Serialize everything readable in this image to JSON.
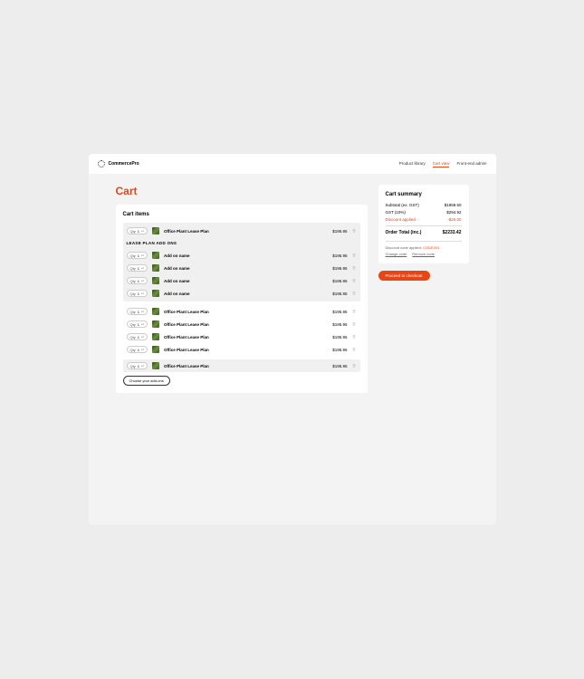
{
  "header": {
    "brand": "CommercePro",
    "nav": [
      "Product library",
      "Cart view",
      "Front-end admin"
    ],
    "nav_active": 1
  },
  "page_title": "Cart",
  "items_card": {
    "title": "Cart items",
    "qty_label": "Qty",
    "addons_heading": "LEASE PLAN ADD ONS",
    "choose_label": "Choose your add-ons"
  },
  "cart": {
    "main_item": {
      "qty": "1",
      "name": "Office Plant Lease Plan",
      "price": "$195.95"
    },
    "addons": [
      {
        "qty": "1",
        "name": "Add on name",
        "price": "$195.95"
      },
      {
        "qty": "1",
        "name": "Add on name",
        "price": "$195.95"
      },
      {
        "qty": "1",
        "name": "Add on name",
        "price": "$195.95"
      },
      {
        "qty": "1",
        "name": "Add on name",
        "price": "$195.95"
      }
    ],
    "other_items": [
      {
        "qty": "1",
        "name": "Office Plant Lease Plan",
        "price": "$195.95"
      },
      {
        "qty": "1",
        "name": "Office Plant Lease Plan",
        "price": "$195.95"
      },
      {
        "qty": "1",
        "name": "Office Plant Lease Plan",
        "price": "$195.95"
      },
      {
        "qty": "1",
        "name": "Office Plant Lease Plan",
        "price": "$195.95"
      }
    ],
    "last_item": {
      "qty": "1",
      "name": "Office Plant Lease Plan",
      "price": "$195.95"
    }
  },
  "summary": {
    "title": "Cart summary",
    "rows": [
      {
        "label": "Subtotal (ex. GST)",
        "value": "$1959.50"
      },
      {
        "label": "GST (10%)",
        "value": "$294.92"
      }
    ],
    "discount": {
      "label": "Discount applied",
      "value": "-$20.00"
    },
    "total": {
      "label": "Order Total (inc.)",
      "value": "$2233.42"
    },
    "code_prefix": "Discount code applied: ",
    "code": "CODE001",
    "change_label": "Change code",
    "remove_label": "Remove code"
  },
  "checkout_label": "Proceed to checkout"
}
